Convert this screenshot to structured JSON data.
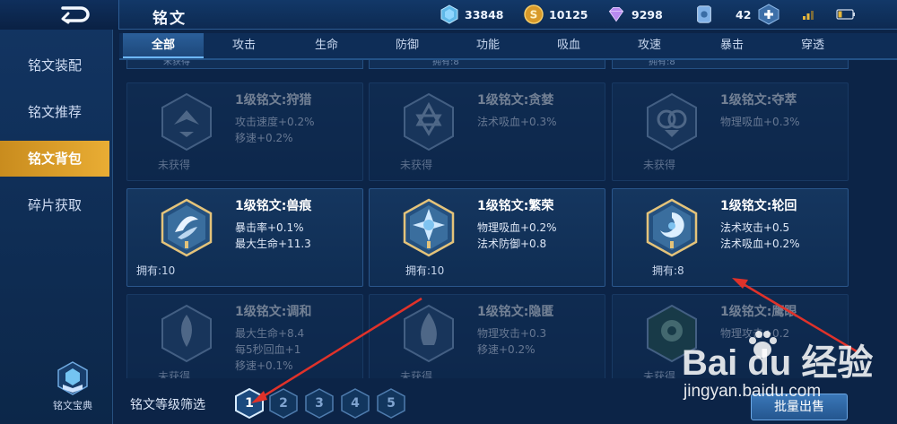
{
  "header": {
    "title": "铭文",
    "currencies": {
      "diamond": "33848",
      "gold": "10125",
      "crystal": "9298",
      "tickets": "42"
    },
    "add_symbol": "+"
  },
  "sidebar": {
    "items": [
      {
        "label": "铭文装配"
      },
      {
        "label": "铭文推荐"
      },
      {
        "label": "铭文背包"
      },
      {
        "label": "碎片获取"
      }
    ],
    "active_index": 2,
    "codex_label": "铭文宝典"
  },
  "tabs": [
    "全部",
    "攻击",
    "生命",
    "防御",
    "功能",
    "吸血",
    "攻速",
    "暴击",
    "穿透"
  ],
  "active_tab": "全部",
  "top_partial": [
    "未获得",
    "拥有:8",
    "拥有:8"
  ],
  "runes": [
    {
      "name": "1级铭文:狩猎",
      "stats": [
        "攻击速度+0.2%",
        "移速+0.2%"
      ],
      "owned": "未获得",
      "acquired": false,
      "icon": "hunt-rune-icon"
    },
    {
      "name": "1级铭文:贪婪",
      "stats": [
        "法术吸血+0.3%"
      ],
      "owned": "未获得",
      "acquired": false,
      "icon": "greed-rune-icon"
    },
    {
      "name": "1级铭文:夺萃",
      "stats": [
        "物理吸血+0.3%"
      ],
      "owned": "未获得",
      "acquired": false,
      "icon": "essence-rune-icon"
    },
    {
      "name": "1级铭文:兽痕",
      "stats": [
        "暴击率+0.1%",
        "最大生命+11.3"
      ],
      "owned": "拥有:10",
      "acquired": true,
      "icon": "beast-mark-rune-icon"
    },
    {
      "name": "1级铭文:繁荣",
      "stats": [
        "物理吸血+0.2%",
        "法术防御+0.8"
      ],
      "owned": "拥有:10",
      "acquired": true,
      "icon": "prosperity-rune-icon"
    },
    {
      "name": "1级铭文:轮回",
      "stats": [
        "法术攻击+0.5",
        "法术吸血+0.2%"
      ],
      "owned": "拥有:8",
      "acquired": true,
      "icon": "samsara-rune-icon"
    },
    {
      "name": "1级铭文:调和",
      "stats": [
        "最大生命+8.4",
        "每5秒回血+1",
        "移速+0.1%"
      ],
      "owned": "未获得",
      "acquired": false,
      "icon": "harmony-rune-icon"
    },
    {
      "name": "1级铭文:隐匿",
      "stats": [
        "物理攻击+0.3",
        "移速+0.2%"
      ],
      "owned": "未获得",
      "acquired": false,
      "icon": "stealth-rune-icon"
    },
    {
      "name": "1级铭文:鹰眼",
      "stats": [
        "物理攻击+0.2"
      ],
      "owned": "未获得",
      "acquired": false,
      "icon": "eagle-eye-rune-icon"
    }
  ],
  "filter": {
    "label": "铭文等级筛选",
    "levels": [
      "1",
      "2",
      "3",
      "4",
      "5"
    ],
    "active_level": "1"
  },
  "bulk_sell_label": "批量出售",
  "watermark": {
    "brand": "Bai du 经验",
    "url": "jingyan.baidu.com"
  },
  "colors": {
    "gold_active": "#e9ad34",
    "accent_blue": "#6db7ff",
    "arrow_red": "#e0322a"
  }
}
